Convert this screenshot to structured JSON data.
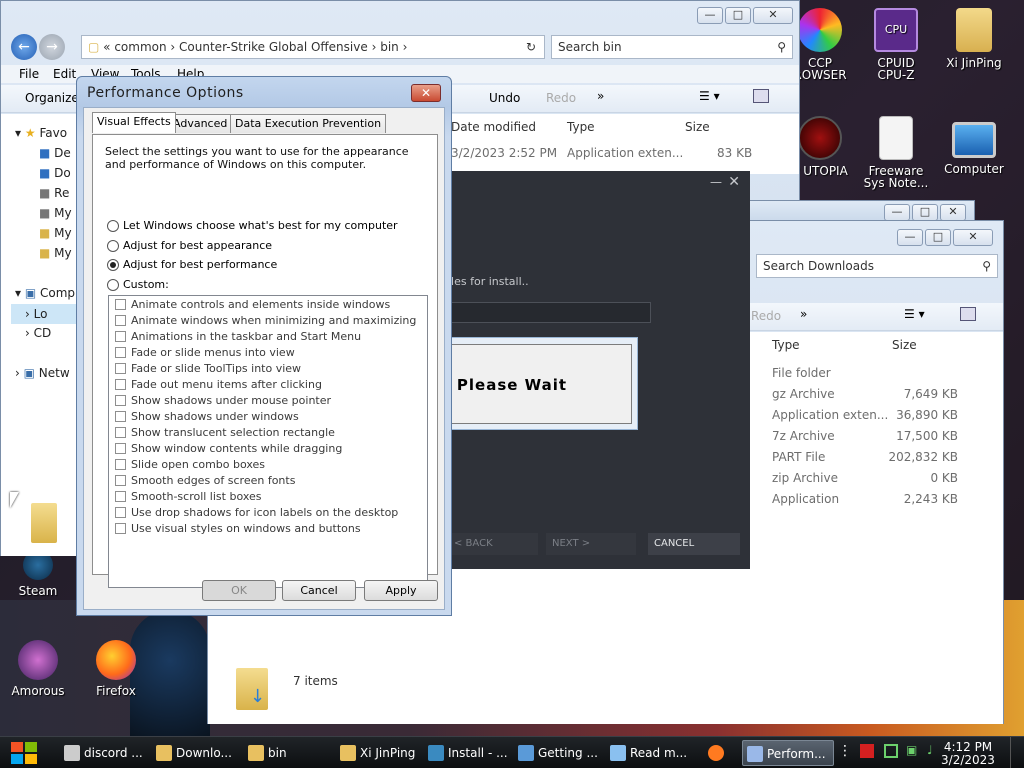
{
  "desktop_icons": [
    {
      "label1": "CCP",
      "label2": "ROWSER",
      "icon": "ccp-browser-icon"
    },
    {
      "label1": "CPUID",
      "label2": "CPU-Z",
      "icon": "cpu-z-icon"
    },
    {
      "label1": "Xi JinPing",
      "label2": "",
      "icon": "user-folder-icon"
    },
    {
      "label1": "P UTOPIA",
      "label2": "",
      "icon": "utopia-icon"
    },
    {
      "label1": "Freeware",
      "label2": "Sys Note...",
      "icon": "document-icon"
    },
    {
      "label1": "Computer",
      "label2": "",
      "icon": "computer-icon"
    },
    {
      "label1": "Steam",
      "label2": "",
      "icon": "steam-icon"
    },
    {
      "label1": "Amorous",
      "label2": "",
      "icon": "amorous-icon"
    },
    {
      "label1": "Firefox",
      "label2": "",
      "icon": "firefox-icon"
    }
  ],
  "explorer_bin": {
    "breadcrumb": [
      "common",
      "Counter-Strike Global Offensive",
      "bin"
    ],
    "search_placeholder": "Search bin",
    "menu": [
      "File",
      "Edit",
      "View",
      "Tools",
      "Help"
    ],
    "toolbar": {
      "organize": "Organize",
      "undo": "Undo",
      "redo": "Redo",
      "more": "»"
    },
    "nav": [
      "Favo",
      "De",
      "Do",
      "Re",
      "My",
      "My",
      "My",
      "Comp",
      "Lo",
      "CD",
      "Netw"
    ],
    "columns": [
      "Date modified",
      "Type",
      "Size"
    ],
    "rows": [
      {
        "date": "3/2/2023 2:52 PM",
        "type": "Application exten...",
        "size": "83 KB"
      }
    ]
  },
  "explorer_downloads": {
    "search_placeholder": "Search Downloads",
    "toolbar": {
      "redo": "Redo",
      "more": "»"
    },
    "columns": [
      "Type",
      "Size"
    ],
    "rows": [
      {
        "type": "File folder",
        "size": ""
      },
      {
        "type": "gz Archive",
        "size": "7,649 KB"
      },
      {
        "type": "Application exten...",
        "size": "36,890 KB"
      },
      {
        "type": "7z Archive",
        "size": "17,500 KB"
      },
      {
        "type": "PART File",
        "size": "202,832 KB"
      },
      {
        "type": "zip Archive",
        "size": "0 KB"
      },
      {
        "type": "Application",
        "size": "2,243 KB"
      }
    ],
    "status": "7 items"
  },
  "perf_options": {
    "title": "Performance Options",
    "tabs": [
      "Visual Effects",
      "Advanced",
      "Data Execution Prevention"
    ],
    "intro": "Select the settings you want to use for the appearance and performance of Windows on this computer.",
    "radios": [
      {
        "label": "Let Windows choose what's best for my computer",
        "checked": false
      },
      {
        "label": "Adjust for best appearance",
        "checked": false
      },
      {
        "label": "Adjust for best performance",
        "checked": true
      },
      {
        "label": "Custom:",
        "checked": false
      }
    ],
    "effects": [
      "Animate controls and elements inside windows",
      "Animate windows when minimizing and maximizing",
      "Animations in the taskbar and Start Menu",
      "Fade or slide menus into view",
      "Fade or slide ToolTips into view",
      "Fade out menu items after clicking",
      "Show shadows under mouse pointer",
      "Show shadows under windows",
      "Show translucent selection rectangle",
      "Show window contents while dragging",
      "Slide open combo boxes",
      "Smooth edges of screen fonts",
      "Smooth-scroll list boxes",
      "Use drop shadows for icon labels on the desktop",
      "Use visual styles on windows and buttons"
    ],
    "buttons": {
      "ok": "OK",
      "cancel": "Cancel",
      "apply": "Apply"
    }
  },
  "steam_install": {
    "message": "iles for install..",
    "back": "< BACK",
    "next": "NEXT >",
    "cancel": "CANCEL"
  },
  "please_wait": "Please Wait",
  "taskbar": {
    "items": [
      {
        "label": "discord ...",
        "icon": "search-icon"
      },
      {
        "label": "Downlo...",
        "icon": "folder-icon"
      },
      {
        "label": "bin",
        "icon": "folder-icon"
      },
      {
        "label": "Xi JinPing",
        "icon": "folder-icon"
      },
      {
        "label": "Install - ...",
        "icon": "steam-icon"
      },
      {
        "label": "Getting ...",
        "icon": "window-icon"
      },
      {
        "label": "Read m...",
        "icon": "notepad-icon"
      },
      {
        "label": "",
        "icon": "firefox-icon"
      },
      {
        "label": "Perform...",
        "icon": "perf-icon"
      }
    ],
    "time": "4:12 PM",
    "date": "3/2/2023"
  }
}
